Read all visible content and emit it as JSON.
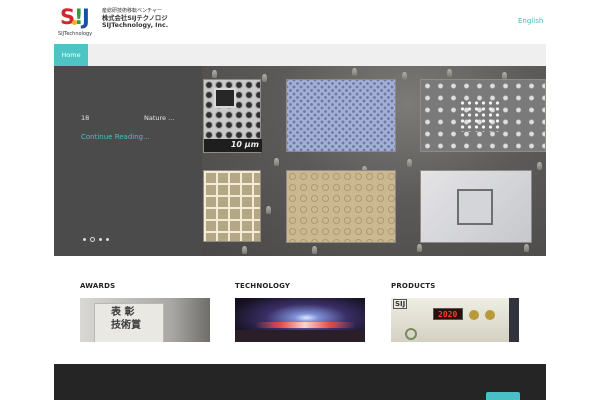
{
  "header": {
    "logo_letters": {
      "s": "S",
      "i": "!",
      "j": "J"
    },
    "logo_sub": "SIJTechnology",
    "company_line1": "産総研技術移転ベンチャー",
    "company_line2": "株式会社SIJテクノロジ",
    "company_line3": "SIJTechnology, Inc.",
    "language_link": "English"
  },
  "nav": {
    "items": [
      {
        "label": "Home",
        "active": true
      }
    ]
  },
  "slider": {
    "slide_number": "18",
    "slide_title": "Nature ...",
    "continue_label": "Continue Reading...",
    "image_caption": "10 µm",
    "dots_count": 4,
    "active_dot": 1
  },
  "sections": [
    {
      "title": "AWARDS",
      "image_text": "表 彰\n技術賞"
    },
    {
      "title": "TECHNOLOGY"
    },
    {
      "title": "PRODUCTS",
      "image_text": "SIJ",
      "display_value": "2020"
    }
  ],
  "colors": {
    "accent": "#4bbfc6",
    "nav_active": "#4fc4c4",
    "logo_red": "#d8242a",
    "logo_green": "#2f9e3a",
    "logo_blue": "#1c4fa0",
    "footer": "#252525"
  }
}
